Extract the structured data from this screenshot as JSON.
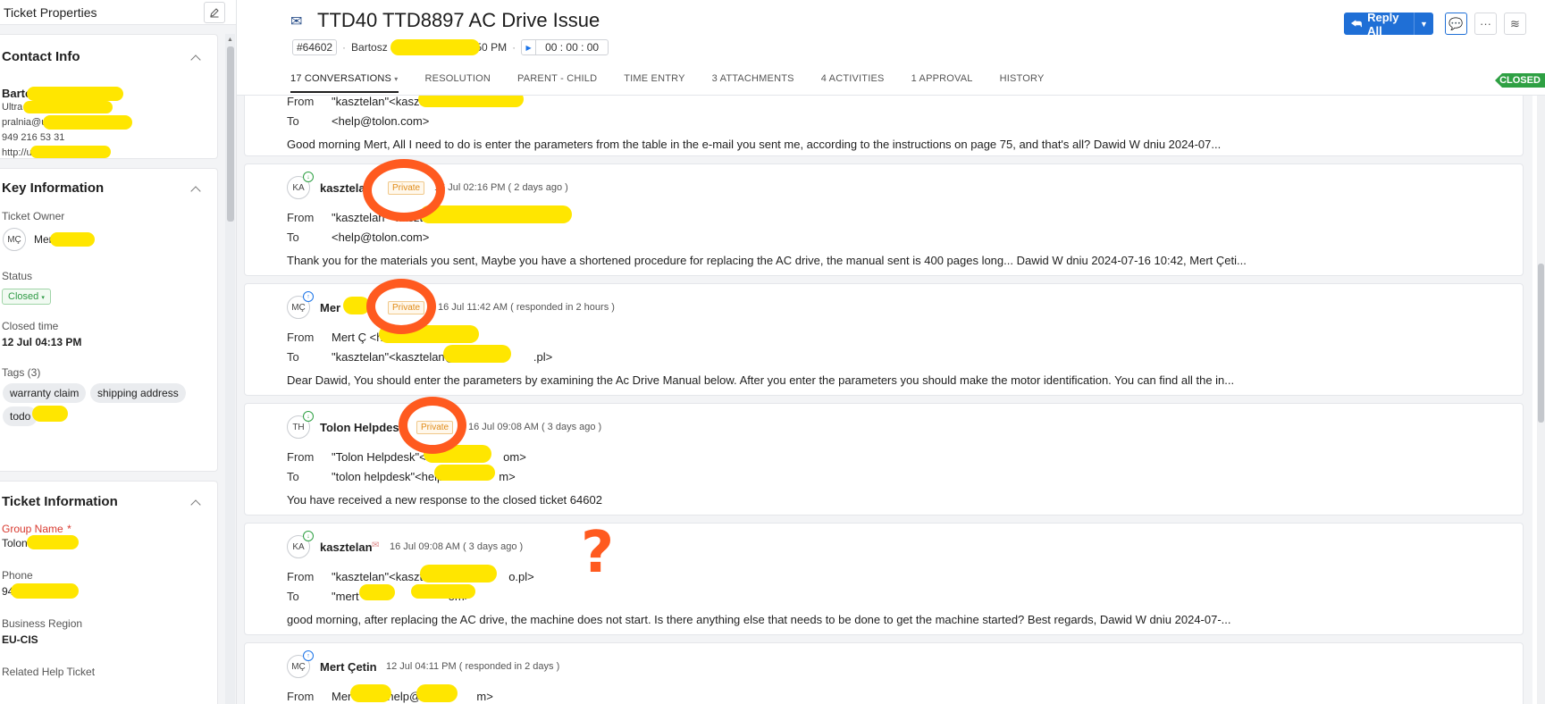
{
  "left_panel": {
    "title": "Ticket Properties",
    "contact": {
      "section_title": "Contact Info",
      "name": "Barto",
      "company": "Ultra",
      "email": "pralnia@u",
      "phone": "949 216 53 31",
      "website": "http://u"
    },
    "key_info": {
      "section_title": "Key Information",
      "owner_label": "Ticket Owner",
      "owner_initials": "MÇ",
      "owner_name": "Mer",
      "status_label": "Status",
      "status_value": "Closed",
      "closed_time_label": "Closed time",
      "closed_time_value": "12 Jul 04:13 PM",
      "tags_label": "Tags (3)",
      "tags": [
        "warranty claim",
        "shipping address",
        "todo"
      ]
    },
    "ticket_info": {
      "section_title": "Ticket Information",
      "group_label": "Group Name",
      "group_required": "*",
      "group_value": "Tolon",
      "phone_label": "Phone",
      "phone_value": "94",
      "region_label": "Business Region",
      "region_value": "EU-CIS",
      "related_label": "Related Help Ticket"
    }
  },
  "header": {
    "subject": "TTD40 TTD8897 AC Drive Issue",
    "ticket_id": "#64602",
    "requester": "Bartosz Ja",
    "created": "08 Jul 12:50 PM",
    "timer": "00 : 00 : 00",
    "reply_all": "Reply All"
  },
  "tabs": [
    {
      "label": "17 CONVERSATIONS",
      "active": true
    },
    {
      "label": "RESOLUTION"
    },
    {
      "label": "PARENT - CHILD"
    },
    {
      "label": "TIME ENTRY"
    },
    {
      "label": "3 ATTACHMENTS"
    },
    {
      "label": "4 ACTIVITIES"
    },
    {
      "label": "1 APPROVAL"
    },
    {
      "label": "HISTORY"
    }
  ],
  "status_badge": "CLOSED",
  "conversations": [
    {
      "from_label": "From",
      "from": "\"kasztelan\"<kasztelan",
      "to_label": "To",
      "to": "<help@tolon.com>",
      "body": "Good morning Mert, All I need to do is enter the parameters from the table in the e-mail you sent me, according to the instructions on page 75, and that's all? Dawid W dniu 2024-07..."
    },
    {
      "initials": "KA",
      "name": "kasztelan",
      "private": "Private",
      "time": "16 Jul 02:16 PM ( 2 days ago )",
      "from_label": "From",
      "from": "\"kasztelan\"<kasztela",
      "to_label": "To",
      "to": "<help@tolon.com>",
      "body": "Thank you for the materials you sent, Maybe you have a shortened procedure for replacing the AC drive, the manual sent is 400 pages long... Dawid W dniu 2024-07-16 10:42, Mert Çeti..."
    },
    {
      "initials": "MÇ",
      "name": "Mer",
      "private": "Private",
      "time": "16 Jul 11:42 AM ( responded in 2 hours )",
      "from_label": "From",
      "from": "Mert Ç <hel",
      "to_label": "To",
      "to": "\"kasztelan\"<kasztelan@",
      "to_suffix": ".pl>",
      "body": "Dear Dawid, You should enter the parameters by examining the Ac Drive Manual below. After you enter the parameters you should make the motor identification. You can find all the in..."
    },
    {
      "initials": "TH",
      "name": "Tolon Helpdesk",
      "private": "Private",
      "time": "16 Jul 09:08 AM ( 3 days ago )",
      "from_label": "From",
      "from": "\"Tolon Helpdesk\"<he",
      "from_suffix": "om>",
      "to_label": "To",
      "to": "\"tolon helpdesk\"<help",
      "to_suffix": "m>",
      "body": "You have received a new response to the closed ticket 64602"
    },
    {
      "initials": "KA",
      "name": "kasztelan",
      "time": "16 Jul 09:08 AM ( 3 days ago )",
      "from_label": "From",
      "from": "\"kasztelan\"<kasztel",
      "from_suffix": "o.pl>",
      "to_label": "To",
      "to": "\"mert",
      "to_suffix": "om>",
      "body": "good morning, after replacing the AC drive, the machine does not start. Is there anything else that needs to be done to get the machine started? Best regards, Dawid W dniu 2024-07-..."
    },
    {
      "initials": "MÇ",
      "name": "Mert Çetin",
      "time": "12 Jul 04:11 PM ( responded in 2 days )",
      "from_label": "From",
      "from": "Mer",
      "from_suffix": "help@tolon",
      "from_end": "m>"
    }
  ],
  "annotation_mark": "?",
  "colors": {
    "accent": "#1f6fd6",
    "closed_badge": "#2ea043",
    "redaction": "#ffe600",
    "annotation": "#ff5a1f"
  }
}
